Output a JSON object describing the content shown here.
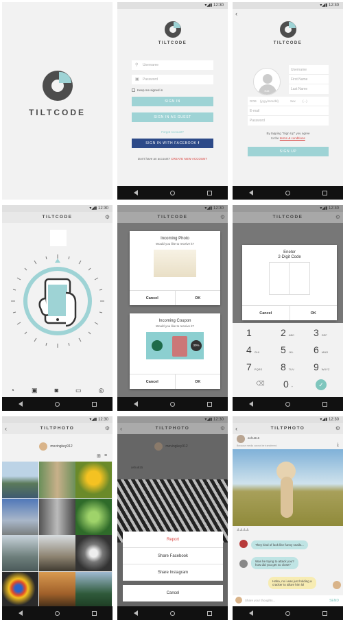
{
  "status_time": "12:30",
  "splash": {
    "brand": "TILTCODE"
  },
  "login": {
    "brand": "TILTCODE",
    "username_ph": "Username",
    "password_ph": "Password",
    "keep_signed": "Keep me signed in",
    "sign_in": "SIGN IN",
    "guest": "SIGN IN AS GUEST",
    "forgot": "Forgot Account?",
    "facebook": "SIGN IN WITH FACEBOOK",
    "no_account": "Don't have an account?",
    "create": "CREATE NEW ACCOUNT"
  },
  "signup": {
    "brand": "TILTCODE",
    "avatar_edit": "Edit",
    "username": "Username",
    "first": "First Name",
    "last": "Last Name",
    "dob_label": "DOB",
    "dob_value": "(yyyy/mm/dd)",
    "sex_label": "Sex",
    "sex_value": "(...)",
    "email": "E-mail",
    "password": "Password",
    "terms_a": "By tapping \"Sign Up\" you agree",
    "terms_b": "to the",
    "terms_link": "terms & conditions",
    "sign_up": "SIGN UP"
  },
  "tilt": {
    "title": "TILTCODE"
  },
  "incoming": {
    "title": "TILTCODE",
    "photo_title": "Incoming Photo",
    "photo_sub": "Would you like to receive it?",
    "coupon_title": "Incoming Coupon",
    "coupon_sub": "Would you like to receive it?",
    "coupon_badge": "30%",
    "cancel": "Cancel",
    "ok": "OK"
  },
  "code": {
    "title": "TILTCODE",
    "dialog_title_1": "Eneter",
    "dialog_title_2": "2-Digit Code",
    "cancel": "Cancel",
    "ok": "OK",
    "keys": [
      {
        "d": "1",
        "l": ""
      },
      {
        "d": "2",
        "l": "ABC"
      },
      {
        "d": "3",
        "l": "DEF"
      },
      {
        "d": "4",
        "l": "GHI"
      },
      {
        "d": "5",
        "l": "JKL"
      },
      {
        "d": "6",
        "l": "MNO"
      },
      {
        "d": "7",
        "l": "PQRS"
      },
      {
        "d": "8",
        "l": "TUV"
      },
      {
        "d": "9",
        "l": "WXYZ"
      },
      {
        "d": "",
        "l": ""
      },
      {
        "d": "0",
        "l": "+"
      },
      {
        "d": "",
        "l": ""
      }
    ]
  },
  "gallery": {
    "title": "TILTPHOTO",
    "user": "movingkey912"
  },
  "share": {
    "title": "TILTPHOTO",
    "user": "movingkey912",
    "commenter": "ashu815",
    "report": "Report",
    "facebook": "Share Facebook",
    "instagram": "Share Instagram",
    "cancel": "Cancel"
  },
  "chat": {
    "title": "TILTPHOTO",
    "user": "ashu815",
    "sub": "Because media cannot be transferred",
    "msg1": "They kind of look like funny snails...",
    "msg2a": "Was he trying to attack you?",
    "msg2b": "how did you get so close?",
    "msg3a": "Haha, no i was just holding a",
    "msg3b": "cracker to allure him lol",
    "input_ph": "Share your thoughts...",
    "send": "SEND"
  },
  "colors": {
    "accent": "#9ed3d5",
    "dark": "#4d4d4d",
    "facebook": "#2d4a88",
    "link": "#d8413d"
  }
}
